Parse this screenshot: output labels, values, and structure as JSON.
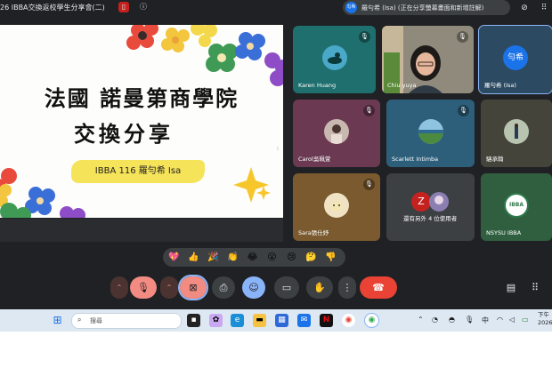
{
  "meeting": {
    "title": "26 IBBA交換返校學生分享會(二)",
    "presenter_avatar": "匀希",
    "presenter_status": "羅勻希 (Isa) (正在分享螢幕畫面和新增註解)"
  },
  "slide": {
    "line1": "法國 諾曼第商學院",
    "line2": "交換分享",
    "label": "IBBA 116 羅勻希 Isa"
  },
  "participants": [
    {
      "name": "Karen Huang",
      "muted": true
    },
    {
      "name": "Chiu yuya",
      "muted": true
    },
    {
      "name": "羅勻希 (Isa)",
      "avatar_text": "勻希",
      "muted": false
    },
    {
      "name": "Carol吳珮萱",
      "muted": true
    },
    {
      "name": "Scarlett Intimba",
      "muted": true
    },
    {
      "name": "駱承翰",
      "muted": false
    },
    {
      "name": "Sara張仕妤",
      "muted": true
    },
    {
      "name": "還有另外 4 位使用者",
      "avatar_letter": "Z",
      "muted": false
    },
    {
      "name": "NSYSU IBBA",
      "badge": "IBBA",
      "muted": false
    }
  ],
  "reactions": [
    "💖",
    "👍",
    "🎉",
    "👏",
    "😂",
    "😮",
    "😢",
    "🤔",
    "👎"
  ],
  "controls": {
    "mic_icon": "mic-off-icon",
    "camera_icon": "camera-off-icon",
    "present_icon": "present-screen-icon",
    "emoji_icon": "emoji-icon",
    "captions_icon": "captions-icon",
    "raise_hand_icon": "raise-hand-icon",
    "more_icon": "more-options-icon",
    "hangup_icon": "hang-up-icon",
    "chat_icon": "chat-icon",
    "apps_icon": "apps-grid-icon"
  },
  "taskbar": {
    "search_placeholder": "搜尋",
    "ime": "中",
    "clock_line1": "下午",
    "clock_line2": "2026"
  },
  "colors": {
    "meet_bg": "#202124",
    "hangup": "#ea4335",
    "active_blue": "#8ab4f8",
    "muted_red": "#f28b82",
    "slide_label_yellow": "#f5e35a"
  }
}
